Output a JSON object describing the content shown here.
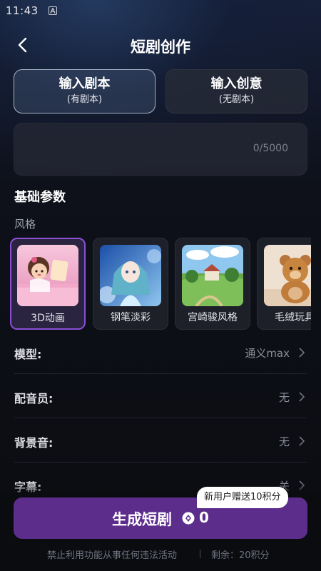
{
  "status_bar": {
    "time": "11:43",
    "notification_icon": "a-square-icon"
  },
  "header": {
    "title": "短剧创作",
    "back_icon": "chevron-left-icon"
  },
  "mode_tabs": [
    {
      "label": "输入剧本",
      "sub": "(有剧本)",
      "active": true
    },
    {
      "label": "输入创意",
      "sub": "(无剧本)",
      "active": false
    }
  ],
  "script_input": {
    "counter": "0/5000"
  },
  "basic_params": {
    "title": "基础参数",
    "style_label": "风格"
  },
  "styles": [
    {
      "name": "3D动画",
      "selected": true
    },
    {
      "name": "钢笔淡彩",
      "selected": false
    },
    {
      "name": "宫崎骏风格",
      "selected": false
    },
    {
      "name": "毛绒玩具",
      "selected": false
    }
  ],
  "settings": [
    {
      "label": "模型:",
      "value": "通义max"
    },
    {
      "label": "配音员:",
      "value": "无"
    },
    {
      "label": "背景音:",
      "value": "无"
    },
    {
      "label": "字幕:",
      "value": "关"
    }
  ],
  "generate": {
    "label": "生成短剧",
    "cost": "0",
    "icon": "coin-icon"
  },
  "promo": {
    "text": "新用户赠送10积分"
  },
  "footer": {
    "warning": "禁止利用功能从事任何违法活动",
    "remaining": "剩余：20积分"
  },
  "colors": {
    "accent": "#5d2d8c",
    "selected_border": "#8b4fd6",
    "background": "#0c0d12"
  }
}
